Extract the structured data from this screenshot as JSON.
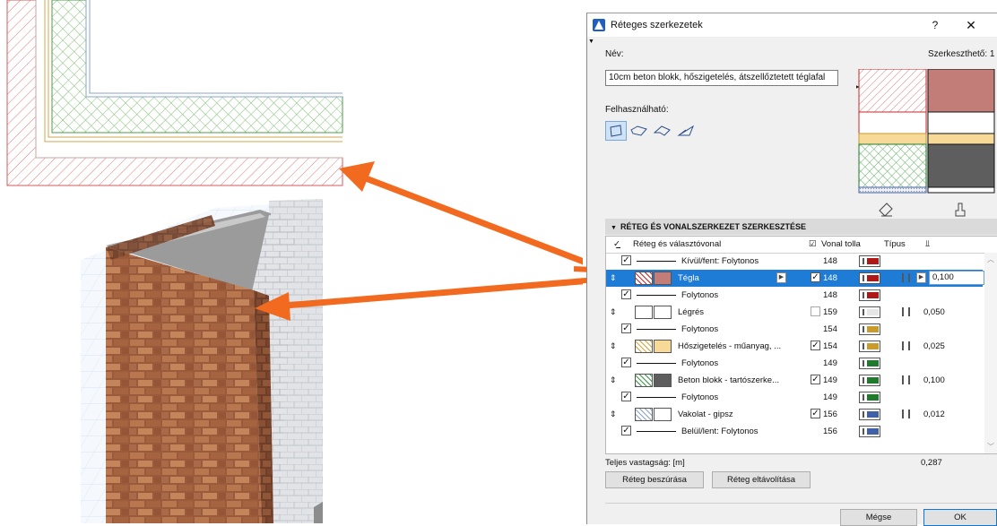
{
  "dialog": {
    "title": "Réteges szerkezetek",
    "help_label": "?",
    "close_label": "✕",
    "name_label": "Név:",
    "editable_label": "Szerkeszthető: 1",
    "name_value": "10cm beton blokk, hőszigetelés, átszellőztetett téglafal",
    "usable_label": "Felhasználható:",
    "usable_icons": [
      "wall-icon",
      "slab-icon",
      "roof-icon",
      "shell-icon"
    ],
    "section_title": "RÉTEG ÉS VONALSZERKEZET SZERKESZTÉSE",
    "columns": {
      "layer": "Réteg és választóvonal",
      "pen": "Vonal tolla",
      "type": "Típus"
    },
    "rows": [
      {
        "kind": "line",
        "checked": true,
        "name": "Kívül/fent: Folytonos",
        "pen": "148",
        "pen_color": "#b01818"
      },
      {
        "kind": "layer",
        "selected": true,
        "name": "Tégla",
        "fill": "#c27d79",
        "hatch": "#c62828",
        "checked": true,
        "pen": "148",
        "pen_color": "#b01818",
        "thickness": "0,100"
      },
      {
        "kind": "line",
        "checked": true,
        "name": "Folytonos",
        "pen": "148",
        "pen_color": "#b01818"
      },
      {
        "kind": "layer",
        "name": "Légrés",
        "fill": "#ffffff",
        "hatch": "",
        "checked": false,
        "pen": "159",
        "pen_color": "#e6e6e6",
        "thickness": "0,050"
      },
      {
        "kind": "line",
        "checked": true,
        "name": "Folytonos",
        "pen": "154",
        "pen_color": "#c99a2c"
      },
      {
        "kind": "layer",
        "name": "Hőszigetelés - műanyag, ...",
        "fill": "#f7d998",
        "hatch": "#d9a53c",
        "checked": true,
        "pen": "154",
        "pen_color": "#c99a2c",
        "thickness": "0,025"
      },
      {
        "kind": "line",
        "checked": true,
        "name": "Folytonos",
        "pen": "149",
        "pen_color": "#1f7a2e"
      },
      {
        "kind": "layer",
        "name": "Beton blokk - tartószerke...",
        "fill": "#5e5e5e",
        "hatch": "#3a9a45",
        "checked": true,
        "pen": "149",
        "pen_color": "#1f7a2e",
        "thickness": "0,100"
      },
      {
        "kind": "line",
        "checked": true,
        "name": "Folytonos",
        "pen": "149",
        "pen_color": "#1f7a2e"
      },
      {
        "kind": "layer",
        "name": "Vakolat - gipsz",
        "fill": "#ffffff",
        "hatch": "#8aa3cc",
        "checked": true,
        "pen": "156",
        "pen_color": "#3f5fa6",
        "thickness": "0,012"
      },
      {
        "kind": "line",
        "checked": true,
        "name": "Belül/lent: Folytonos",
        "pen": "156",
        "pen_color": "#3f5fa6"
      }
    ],
    "total_label": "Teljes vastagság: [m]",
    "total_value": "0,287",
    "insert_button": "Réteg beszúrása",
    "remove_button": "Réteg eltávolítása",
    "cancel_button": "Mégse",
    "ok_button": "OK"
  },
  "colors": {
    "accent": "#1e7bd6",
    "arrow": "#f26a1f",
    "brick": "#c27d79",
    "insulation": "#f7d998",
    "concrete": "#5e5e5e"
  }
}
